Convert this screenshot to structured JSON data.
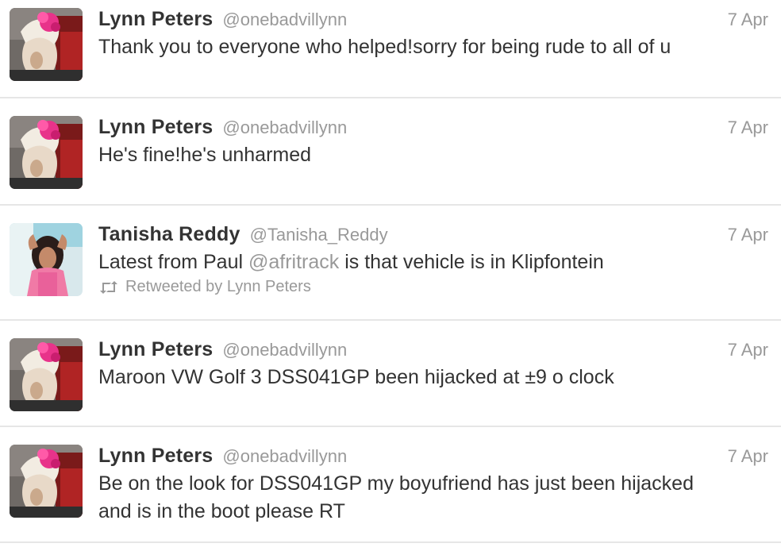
{
  "colors": {
    "text": "#333333",
    "muted": "#999999",
    "divider": "#e6e6e6",
    "pink_hair": "#e8338a"
  },
  "tweets": [
    {
      "name": "Lynn Peters",
      "handle": "@onebadvillynn",
      "time": "7 Apr",
      "text": "Thank you to everyone who helped!sorry for being rude to all of u",
      "avatar_icon": "lynn-avatar"
    },
    {
      "name": "Lynn Peters",
      "handle": "@onebadvillynn",
      "time": "7 Apr",
      "text": "He's fine!he's unharmed",
      "avatar_icon": "lynn-avatar"
    },
    {
      "name": "Tanisha Reddy",
      "handle": "@Tanisha_Reddy",
      "time": "7 Apr",
      "text_before": "Latest from Paul ",
      "mention": "@afritrack",
      "text_after": " is that vehicle is in Klipfontein",
      "retweeted_by": "Retweeted by Lynn Peters",
      "retweet_icon": "retweet-icon",
      "avatar_icon": "tanisha-avatar"
    },
    {
      "name": "Lynn Peters",
      "handle": "@onebadvillynn",
      "time": "7 Apr",
      "text": "Maroon VW Golf 3 DSS041GP been hijacked at ±9 o clock",
      "avatar_icon": "lynn-avatar"
    },
    {
      "name": "Lynn Peters",
      "handle": "@onebadvillynn",
      "time": "7 Apr",
      "text_line1": "Be on the look for DSS041GP my boyufriend has just been hijacked",
      "text_line2": "and is in the boot please RT",
      "avatar_icon": "lynn-avatar"
    }
  ]
}
